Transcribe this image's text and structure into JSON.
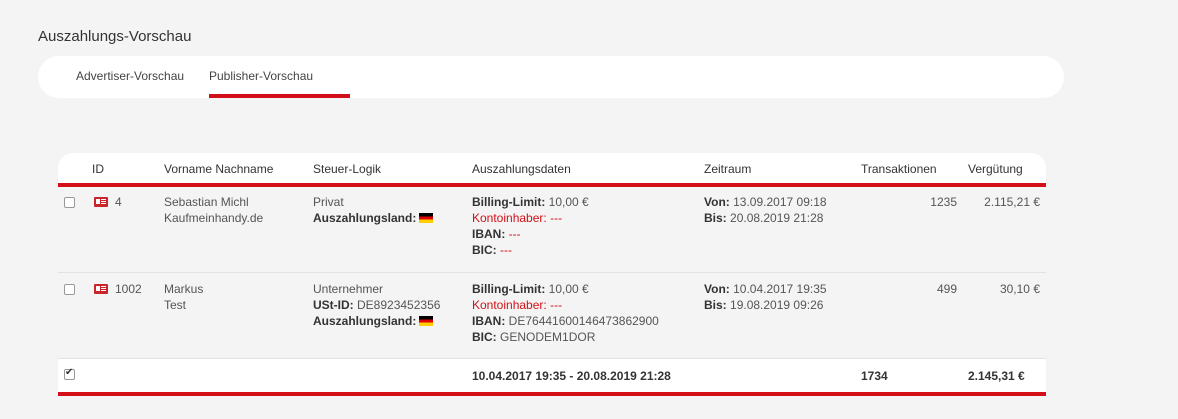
{
  "page_title": "Auszahlungs-Vorschau",
  "tabs": [
    {
      "label": "Advertiser-Vorschau",
      "active": false
    },
    {
      "label": "Publisher-Vorschau",
      "active": true
    }
  ],
  "accent_color": "#d31017",
  "table": {
    "headers": {
      "id": "ID",
      "name": "Vorname Nachname",
      "tax": "Steuer-Logik",
      "payout": "Auszahlungsdaten",
      "period": "Zeitraum",
      "transactions": "Transaktionen",
      "payment": "Vergütung"
    },
    "rows": [
      {
        "checked": false,
        "id": "4",
        "name_line1": "Sebastian Michl",
        "name_line2": "Kaufmeinhandy.de",
        "tax_type": "Privat",
        "ustid_label": "",
        "ustid_value": "",
        "country_label": "Auszahlungsland:",
        "billing_label": "Billing-Limit:",
        "billing_value": "10,00 €",
        "holder_label": "Kontoinhaber:",
        "holder_value": "---",
        "iban_label": "IBAN:",
        "iban_value": "---",
        "bic_label": "BIC:",
        "bic_value": "---",
        "von_label": "Von:",
        "von_value": "13.09.2017 09:18",
        "bis_label": "Bis:",
        "bis_value": "20.08.2019 21:28",
        "transactions": "1235",
        "payment": "2.115,21 €"
      },
      {
        "checked": false,
        "id": "1002",
        "name_line1": "Markus",
        "name_line2": "Test",
        "tax_type": "Unternehmer",
        "ustid_label": "USt-ID:",
        "ustid_value": "DE8923452356",
        "country_label": "Auszahlungsland:",
        "billing_label": "Billing-Limit:",
        "billing_value": "10,00 €",
        "holder_label": "Kontoinhaber:",
        "holder_value": "---",
        "iban_label": "IBAN:",
        "iban_value": "DE76441600146473862900",
        "bic_label": "BIC:",
        "bic_value": "GENODEM1DOR",
        "von_label": "Von:",
        "von_value": "10.04.2017 19:35",
        "bis_label": "Bis:",
        "bis_value": "19.08.2019 09:26",
        "transactions": "499",
        "payment": "30,10 €"
      }
    ],
    "summary": {
      "checked": true,
      "period": "10.04.2017 19:35 - 20.08.2019 21:28",
      "transactions": "1734",
      "payment": "2.145,31 €"
    }
  }
}
